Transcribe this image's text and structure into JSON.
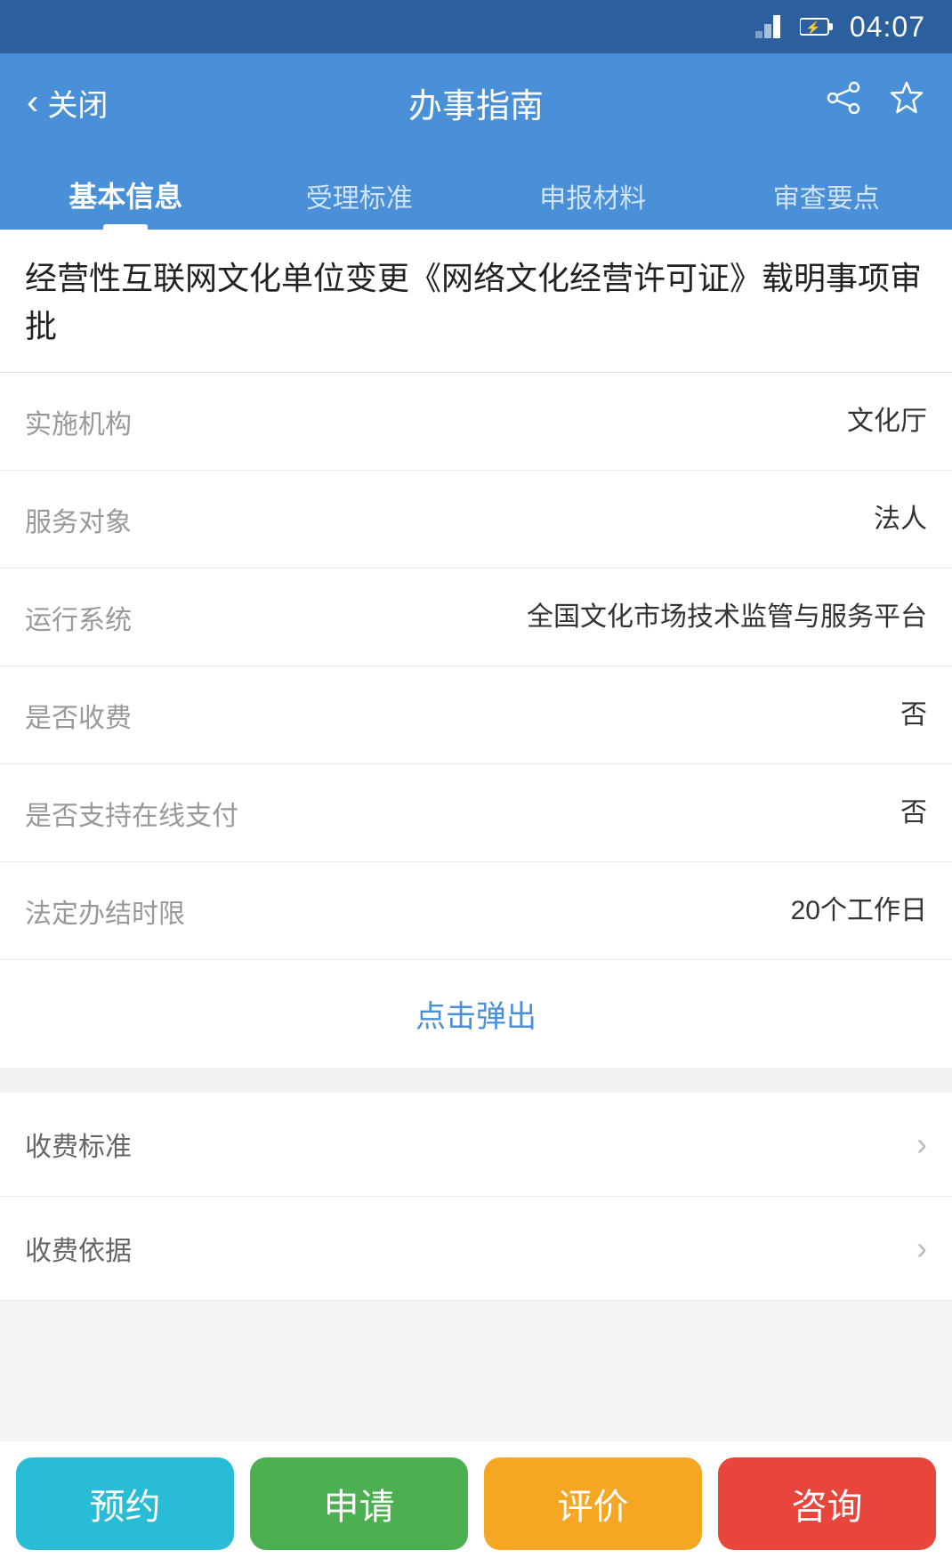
{
  "statusBar": {
    "time": "04:07"
  },
  "topNav": {
    "backLabel": "关闭",
    "title": "办事指南"
  },
  "tabs": [
    {
      "id": "basic",
      "label": "基本信息",
      "active": true
    },
    {
      "id": "standard",
      "label": "受理标准",
      "active": false
    },
    {
      "id": "materials",
      "label": "申报材料",
      "active": false
    },
    {
      "id": "review",
      "label": "审查要点",
      "active": false
    }
  ],
  "pageTitle": "经营性互联网文化单位变更《网络文化经营许可证》载明事项审批",
  "infoRows": [
    {
      "label": "实施机构",
      "value": "文化厅"
    },
    {
      "label": "服务对象",
      "value": "法人"
    },
    {
      "label": "运行系统",
      "value": "全国文化市场技术监管与服务平台"
    },
    {
      "label": "是否收费",
      "value": "否"
    },
    {
      "label": "是否支持在线支付",
      "value": "否"
    },
    {
      "label": "法定办结时限",
      "value": "20个工作日"
    }
  ],
  "popupButton": "点击弹出",
  "arrowRows": [
    {
      "label": "收费标准"
    },
    {
      "label": "收费依据"
    }
  ],
  "bottomButtons": [
    {
      "id": "reserve",
      "label": "预约",
      "class": "btn-reserve"
    },
    {
      "id": "apply",
      "label": "申请",
      "class": "btn-apply"
    },
    {
      "id": "review",
      "label": "评价",
      "class": "btn-review"
    },
    {
      "id": "consult",
      "label": "咨询",
      "class": "btn-consult"
    }
  ]
}
